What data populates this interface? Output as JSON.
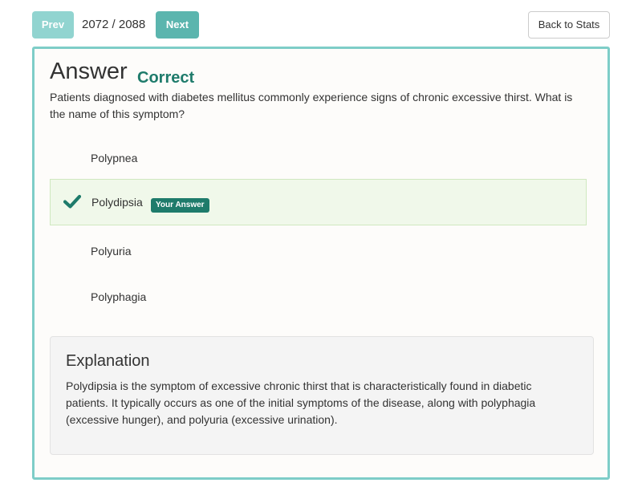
{
  "nav": {
    "prev_label": "Prev",
    "next_label": "Next",
    "counter": "2072 / 2088",
    "back_label": "Back to Stats"
  },
  "answer": {
    "heading": "Answer",
    "status": "Correct",
    "status_color": "#1e7b6b",
    "question": "Patients diagnosed with diabetes mellitus commonly experience signs of chronic excessive thirst. What is the name of this symptom?",
    "options": [
      {
        "label": "Polypnea",
        "selected": false
      },
      {
        "label": "Polydipsia",
        "selected": true,
        "badge": "Your Answer",
        "icon": "checkmark-icon"
      },
      {
        "label": "Polyuria",
        "selected": false
      },
      {
        "label": "Polyphagia",
        "selected": false
      }
    ]
  },
  "explanation": {
    "title": "Explanation",
    "text": "Polydipsia is the symptom of excessive chronic thirst that is characteristically found in diabetic patients. It typically occurs as one of the initial symptoms of the disease, along with polyphagia (excessive hunger), and polyuria (excessive urination)."
  },
  "colors": {
    "accent": "#7ecdc8",
    "correct": "#1e7b6b",
    "selected_bg": "#f0f8ea"
  }
}
